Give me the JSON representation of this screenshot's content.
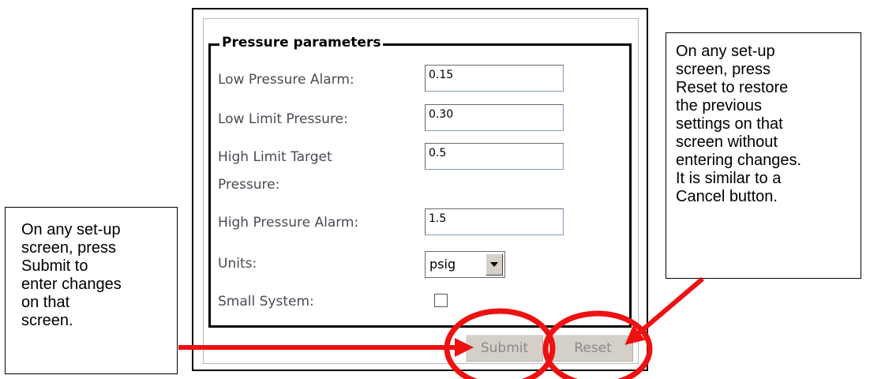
{
  "form": {
    "legend": "Pressure parameters",
    "fields": [
      {
        "label": "Low Pressure Alarm:",
        "value": "0.15"
      },
      {
        "label": "Low Limit Pressure:",
        "value": "0.30"
      },
      {
        "label_line1": "High Limit Target",
        "label_line2": "Pressure:",
        "value": "0.5"
      },
      {
        "label": "High Pressure Alarm:",
        "value": "1.5"
      }
    ],
    "units_label": "Units:",
    "units_value": "psig",
    "small_system_label": "Small System:",
    "small_system_checked": false,
    "submit_label": "Submit",
    "reset_label": "Reset"
  },
  "annotations": {
    "right_callout_lines": [
      "On any set-up",
      "screen, press",
      "Reset to restore",
      "the previous",
      "settings on that",
      "screen without",
      "entering changes.",
      "It is similar to a",
      "Cancel button."
    ],
    "left_callout_lines": [
      "On any set-up",
      "screen, press",
      "Submit to",
      "enter changes",
      "on that",
      "screen."
    ]
  },
  "colors": {
    "arrow": "#ee1111",
    "label_text": "#4a4a55",
    "button_face": "#d4d0c8",
    "button_text_disabled": "#8a8a8a"
  }
}
